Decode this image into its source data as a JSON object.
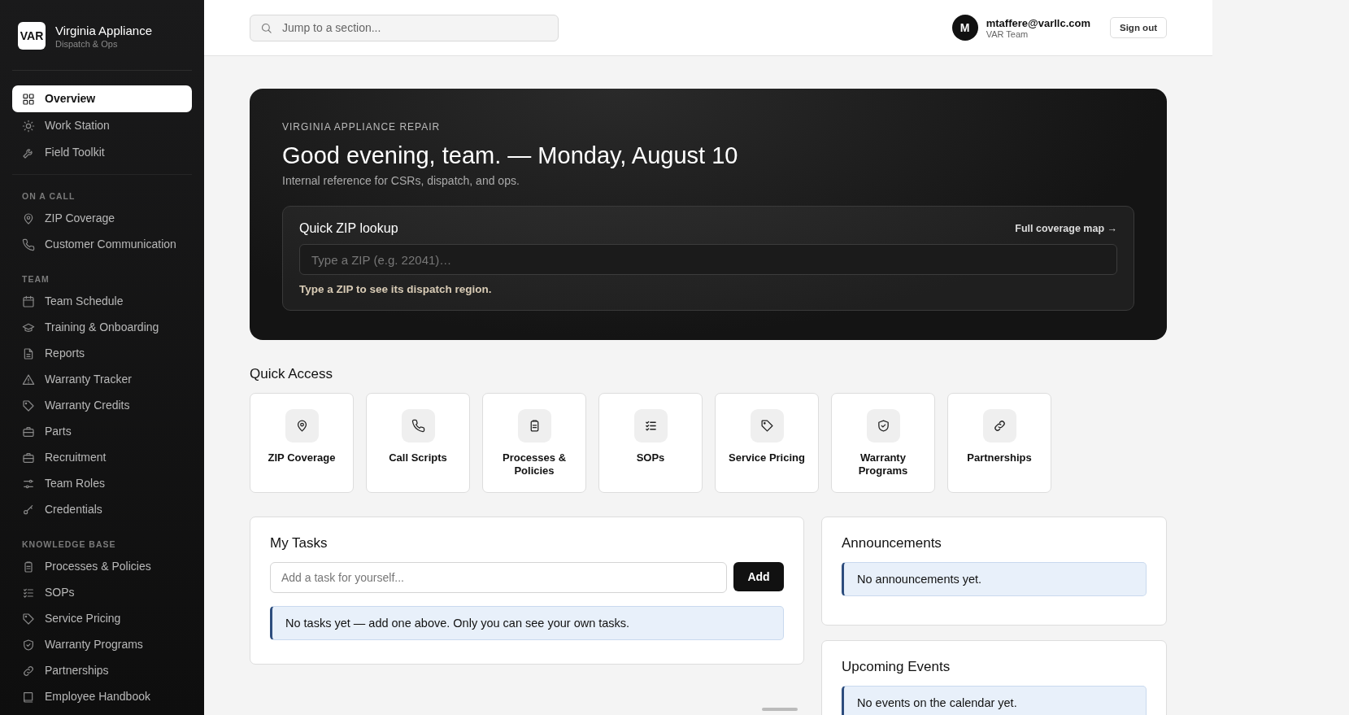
{
  "sidebar": {
    "logo": "VAR",
    "title": "Virginia Appliance",
    "subtitle": "Dispatch & Ops",
    "groups": [
      {
        "items": [
          {
            "label": "Overview",
            "selected": true
          },
          {
            "label": "Work Station",
            "selected": false
          },
          {
            "label": "Field Toolkit",
            "selected": false
          }
        ]
      },
      {
        "heading": "ON A CALL",
        "items": [
          {
            "label": "ZIP Coverage",
            "selected": false
          },
          {
            "label": "Customer Communication",
            "selected": false
          }
        ]
      },
      {
        "heading": "TEAM",
        "items": [
          {
            "label": "Team Schedule",
            "selected": false
          },
          {
            "label": "Training & Onboarding",
            "selected": false
          },
          {
            "label": "Reports",
            "selected": false
          },
          {
            "label": "Warranty Tracker",
            "selected": false
          },
          {
            "label": "Warranty Credits",
            "selected": false
          },
          {
            "label": "Parts",
            "selected": false
          },
          {
            "label": "Recruitment",
            "selected": false
          },
          {
            "label": "Team Roles",
            "selected": false
          },
          {
            "label": "Credentials",
            "selected": false
          }
        ]
      },
      {
        "heading": "KNOWLEDGE BASE",
        "items": [
          {
            "label": "Processes & Policies",
            "selected": false
          },
          {
            "label": "SOPs",
            "selected": false
          },
          {
            "label": "Service Pricing",
            "selected": false
          },
          {
            "label": "Warranty Programs",
            "selected": false
          },
          {
            "label": "Partnerships",
            "selected": false
          },
          {
            "label": "Employee Handbook",
            "selected": false
          }
        ]
      }
    ]
  },
  "header": {
    "search_placeholder": "Jump to a section...",
    "avatar": "M",
    "email": "mtaffere@varllc.com",
    "team": "VAR Team",
    "sign_out": "Sign out"
  },
  "hero": {
    "eyebrow": "VIRGINIA APPLIANCE REPAIR",
    "title": "Good evening, team. — Monday, August 10",
    "subtitle": "Internal reference for CSRs, dispatch, and ops.",
    "zip_lookup": {
      "title": "Quick ZIP lookup",
      "link": "Full coverage map →",
      "placeholder": "Type a ZIP (e.g. 22041)…",
      "hint": "Type a ZIP to see its dispatch region."
    }
  },
  "quick_access": {
    "title": "Quick Access",
    "items": [
      "ZIP Coverage",
      "Call Scripts",
      "Processes & Policies",
      "SOPs",
      "Service Pricing",
      "Warranty Programs",
      "Partnerships"
    ]
  },
  "tasks": {
    "title": "My Tasks",
    "placeholder": "Add a task for yourself...",
    "button": "Add",
    "empty": "No tasks yet — add one above. Only you can see your own tasks."
  },
  "announcements": {
    "title": "Announcements",
    "empty": "No announcements yet."
  },
  "events": {
    "title": "Upcoming Events",
    "empty": "No events on the calendar yet."
  }
}
